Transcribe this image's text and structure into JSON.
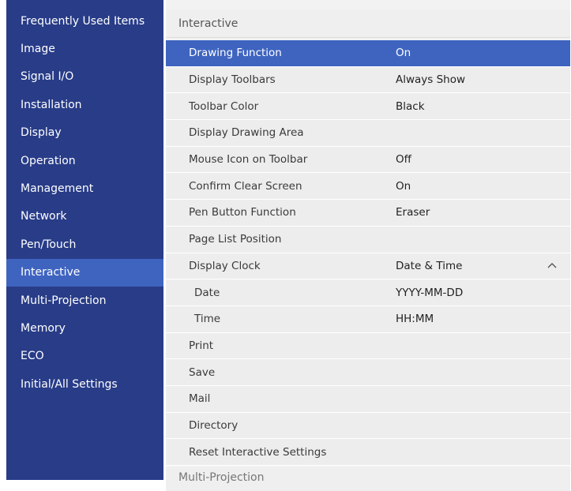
{
  "sidebar": {
    "items": [
      {
        "label": "Frequently Used Items"
      },
      {
        "label": "Image"
      },
      {
        "label": "Signal I/O"
      },
      {
        "label": "Installation"
      },
      {
        "label": "Display"
      },
      {
        "label": "Operation"
      },
      {
        "label": "Management"
      },
      {
        "label": "Network"
      },
      {
        "label": "Pen/Touch"
      },
      {
        "label": "Interactive",
        "selected": true
      },
      {
        "label": "Multi-Projection"
      },
      {
        "label": "Memory"
      },
      {
        "label": "ECO"
      },
      {
        "label": "Initial/All Settings"
      }
    ]
  },
  "main": {
    "section_title": "Interactive",
    "next_section_title": "Multi-Projection",
    "rows": [
      {
        "label": "Drawing Function",
        "value": "On",
        "selected": true
      },
      {
        "label": "Display Toolbars",
        "value": "Always Show"
      },
      {
        "label": "Toolbar Color",
        "value": "Black"
      },
      {
        "label": "Display Drawing Area",
        "value": ""
      },
      {
        "label": "Mouse Icon on Toolbar",
        "value": "Off"
      },
      {
        "label": "Confirm Clear Screen",
        "value": "On"
      },
      {
        "label": "Pen Button Function",
        "value": "Eraser"
      },
      {
        "label": "Page List Position",
        "value": ""
      },
      {
        "label": "Display Clock",
        "value": "Date & Time",
        "expanded": true
      },
      {
        "label": "Date",
        "value": "YYYY-MM-DD",
        "sub": true
      },
      {
        "label": "Time",
        "value": "HH:MM",
        "sub": true
      },
      {
        "label": "Print",
        "value": ""
      },
      {
        "label": "Save",
        "value": ""
      },
      {
        "label": "Mail",
        "value": ""
      },
      {
        "label": "Directory",
        "value": ""
      },
      {
        "label": "Reset Interactive Settings",
        "value": ""
      }
    ]
  },
  "colors": {
    "sidebar_bg": "#283c88",
    "selected_bg": "#3f64c0",
    "main_bg": "#ededed"
  },
  "icons": {
    "expand": "chevron-up-icon"
  }
}
